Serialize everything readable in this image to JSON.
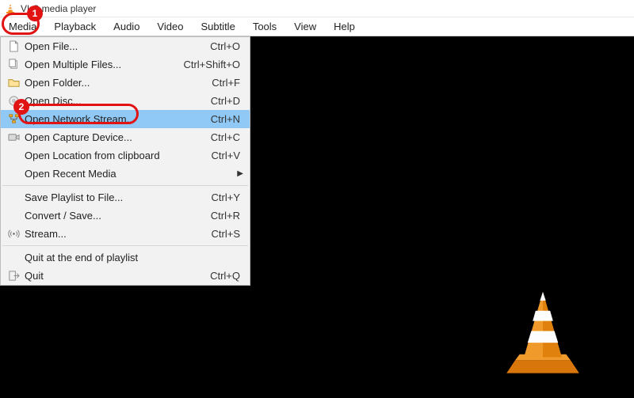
{
  "titlebar": {
    "title": "VLC media player"
  },
  "menubar": {
    "items": [
      {
        "label": "Media",
        "active": true
      },
      {
        "label": "Playback"
      },
      {
        "label": "Audio"
      },
      {
        "label": "Video"
      },
      {
        "label": "Subtitle"
      },
      {
        "label": "Tools"
      },
      {
        "label": "View"
      },
      {
        "label": "Help"
      }
    ]
  },
  "dropdown": {
    "rows": [
      {
        "type": "item",
        "icon": "file-icon",
        "label": "Open File...",
        "shortcut": "Ctrl+O"
      },
      {
        "type": "item",
        "icon": "files-icon",
        "label": "Open Multiple Files...",
        "shortcut": "Ctrl+Shift+O"
      },
      {
        "type": "item",
        "icon": "folder-icon",
        "label": "Open Folder...",
        "shortcut": "Ctrl+F"
      },
      {
        "type": "item",
        "icon": "disc-icon",
        "label": "Open Disc...",
        "shortcut": "Ctrl+D"
      },
      {
        "type": "item",
        "icon": "network-icon",
        "label": "Open Network Stream...",
        "shortcut": "Ctrl+N",
        "highlight": true
      },
      {
        "type": "item",
        "icon": "capture-icon",
        "label": "Open Capture Device...",
        "shortcut": "Ctrl+C"
      },
      {
        "type": "item",
        "icon": "",
        "label": "Open Location from clipboard",
        "shortcut": "Ctrl+V"
      },
      {
        "type": "item",
        "icon": "",
        "label": "Open Recent Media",
        "shortcut": "",
        "submenu": true
      },
      {
        "type": "sep"
      },
      {
        "type": "item",
        "icon": "",
        "label": "Save Playlist to File...",
        "shortcut": "Ctrl+Y"
      },
      {
        "type": "item",
        "icon": "",
        "label": "Convert / Save...",
        "shortcut": "Ctrl+R"
      },
      {
        "type": "item",
        "icon": "stream-icon",
        "label": "Stream...",
        "shortcut": "Ctrl+S"
      },
      {
        "type": "sep"
      },
      {
        "type": "item",
        "icon": "",
        "label": "Quit at the end of playlist",
        "shortcut": ""
      },
      {
        "type": "item",
        "icon": "quit-icon",
        "label": "Quit",
        "shortcut": "Ctrl+Q"
      }
    ]
  },
  "callouts": {
    "1": "1",
    "2": "2"
  },
  "icons": {
    "app": "vlc-cone-icon"
  }
}
